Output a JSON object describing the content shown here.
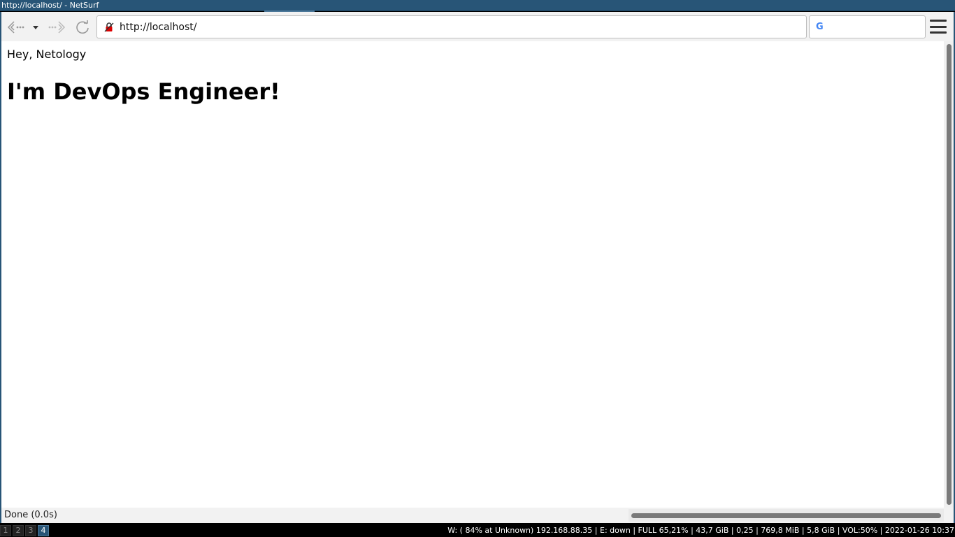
{
  "window": {
    "title": "http://localhost/ - NetSurf"
  },
  "toolbar": {
    "back_icon": "back-arrow-icon",
    "history_icon": "dropdown-arrow-icon",
    "forward_icon": "forward-arrow-icon",
    "reload_icon": "reload-icon",
    "menu_icon": "hamburger-menu-icon"
  },
  "urlbar": {
    "value": "http://localhost/",
    "icon": "insecure-lock-icon"
  },
  "searchbar": {
    "engine_icon": "G",
    "value": ""
  },
  "page": {
    "greeting": "Hey, Netology",
    "heading": "I'm DevOps Engineer!"
  },
  "status": {
    "text": "Done (0.0s)"
  },
  "taskbar": {
    "workspaces": [
      "1",
      "2",
      "3",
      "4"
    ],
    "active_workspace": "4",
    "sysinfo": "W: ( 84% at Unknown) 192.168.88.35 | E: down | FULL 65,21% | 43,7 GiB | 0,25 | 769,8 MiB | 5,8 GiB | VOL:50% | 2022-01-26 10:37"
  },
  "colors": {
    "titlebar": "#285577",
    "active_workspace": "#285577"
  }
}
